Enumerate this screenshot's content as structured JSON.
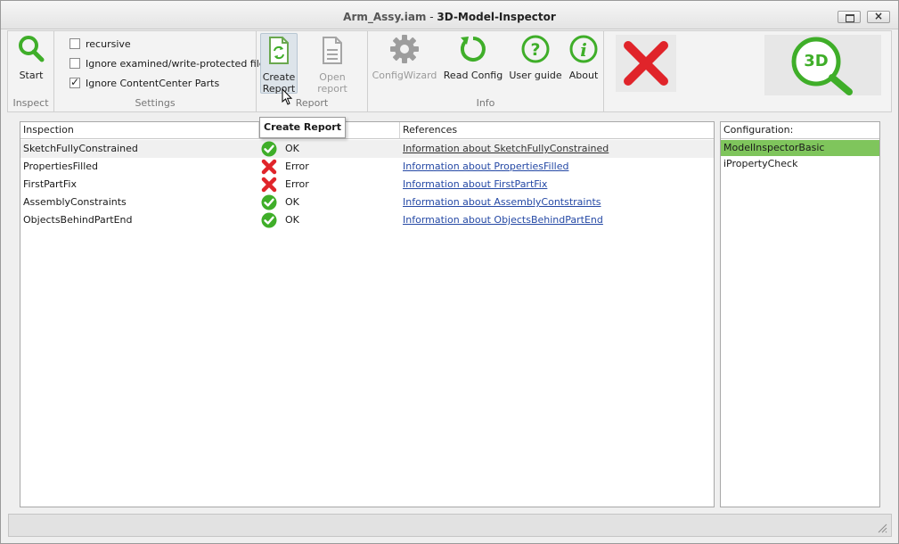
{
  "window": {
    "title_file": "Arm_Assy.iam",
    "title_sep": " - ",
    "title_app": "3D-Model-Inspector"
  },
  "ribbon": {
    "inspect": {
      "label": "Inspect",
      "start": "Start"
    },
    "settings": {
      "label": "Settings",
      "options": [
        {
          "label": "recursive",
          "checked": false
        },
        {
          "label": "Ignore examined/write-protected files",
          "checked": false
        },
        {
          "label": "Ignore ContentCenter Parts",
          "checked": true
        }
      ]
    },
    "report": {
      "label": "Report",
      "create_line1": "Create",
      "create_line2": "Report",
      "open": "Open report"
    },
    "info": {
      "label": "Info",
      "config_wizard": "ConfigWizard",
      "read_config": "Read Config",
      "user_guide": "User guide",
      "about": "About"
    },
    "logo_text": "3D MODEL INSPECTOR"
  },
  "tooltip": "Create Report",
  "grid": {
    "columns": [
      "Inspection",
      "",
      "References"
    ],
    "rows": [
      {
        "name": "SketchFullyConstrained",
        "status": "OK",
        "ok": true,
        "link": "Information about SketchFullyConstrained"
      },
      {
        "name": "PropertiesFilled",
        "status": "Error",
        "ok": false,
        "link": "Information about PropertiesFilled"
      },
      {
        "name": "FirstPartFix",
        "status": "Error",
        "ok": false,
        "link": "Information about FirstPartFix"
      },
      {
        "name": "AssemblyConstraints",
        "status": "OK",
        "ok": true,
        "link": "Information about AssemblyContstraints"
      },
      {
        "name": "ObjectsBehindPartEnd",
        "status": "OK",
        "ok": true,
        "link": "Information about ObjectsBehindPartEnd"
      }
    ]
  },
  "configuration": {
    "header": "Configuration:",
    "items": [
      "ModelInspectorBasic",
      "iPropertyCheck"
    ],
    "selected_index": 0
  },
  "colors": {
    "green": "#3fae29",
    "red": "#e0242a",
    "selection": "#7fc55c",
    "link": "#2549a5"
  }
}
